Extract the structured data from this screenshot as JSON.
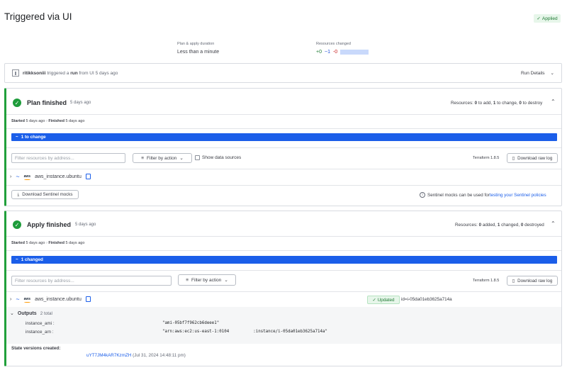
{
  "header": {
    "title": "Triggered via UI",
    "status_badge": "Applied"
  },
  "summary": {
    "duration_label": "Plan & apply duration",
    "duration_value": "Less than a minute",
    "resources_label": "Resources changed",
    "resources_add": "+0",
    "resources_change": "~1",
    "resources_destroy": "-0"
  },
  "trigger": {
    "user": "ritikksoniii",
    "text_mid": " triggered a ",
    "run_word": "run",
    "text_tail": " from UI 5 days ago",
    "run_details_label": "Run Details"
  },
  "plan": {
    "title": "Plan finished",
    "ago": "5 days ago",
    "resources_prefix": "Resources: ",
    "add_count": "0",
    "add_text": " to add, ",
    "change_count": "1",
    "change_text": " to change, ",
    "destroy_count": "0",
    "destroy_text": " to destroy",
    "started_label": "Started",
    "started_value": "5 days ago",
    "finished_label": "Finished",
    "finished_value": "5 days ago",
    "change_bar_label": "1 to change",
    "filter_placeholder": "Filter resources by address...",
    "filter_action_label": "Filter by action",
    "show_data_sources_label": "Show data sources",
    "terraform_version": "Terraform 1.8.5",
    "download_raw_log_label": "Download raw log",
    "resource_name": "aws_instance.ubuntu",
    "aws_logo_text": "aws",
    "sentinel_button_label": "Download Sentinel mocks",
    "sentinel_note": "Sentinel mocks can be used for ",
    "sentinel_link": "testing your Sentinel policies"
  },
  "apply": {
    "title": "Apply finished",
    "ago": "5 days ago",
    "resources_prefix": "Resources: ",
    "add_count": "0",
    "add_text": " added, ",
    "change_count": "1",
    "change_text": " changed, ",
    "destroy_count": "0",
    "destroy_text": " destroyed",
    "started_label": "Started",
    "started_value": "5 days ago",
    "finished_label": "Finished",
    "finished_value": "5 days ago",
    "change_bar_label": "1 changed",
    "filter_placeholder": "Filter resources by address...",
    "filter_action_label": "Filter by action",
    "terraform_version": "Terraform 1.8.5",
    "download_raw_log_label": "Download raw log",
    "resource_name": "aws_instance.ubuntu",
    "aws_logo_text": "aws",
    "updated_badge": "Updated",
    "resource_id": "id=i-05da01eb3625a714a",
    "outputs_label": "Outputs",
    "outputs_count": "2 total",
    "outputs": [
      {
        "key": "instance_ami :",
        "value": "\"ami-05bf7f962cb6deee1\""
      },
      {
        "key": "instance_arn :",
        "value_prefix": "\"arn:aws:ec2:us-east-1:0104",
        "value_suffix": ":instance/i-05da01eb3625a714a\""
      }
    ],
    "state_versions_label": "State versions created:",
    "state_version_id": "uYT7JM4kAR7KzmZH",
    "state_version_time": " (Jul 31, 2024 14:48:11 pm)"
  },
  "colors": {
    "accent_blue": "#1b5ee9",
    "success_green": "#1e9c3b"
  }
}
